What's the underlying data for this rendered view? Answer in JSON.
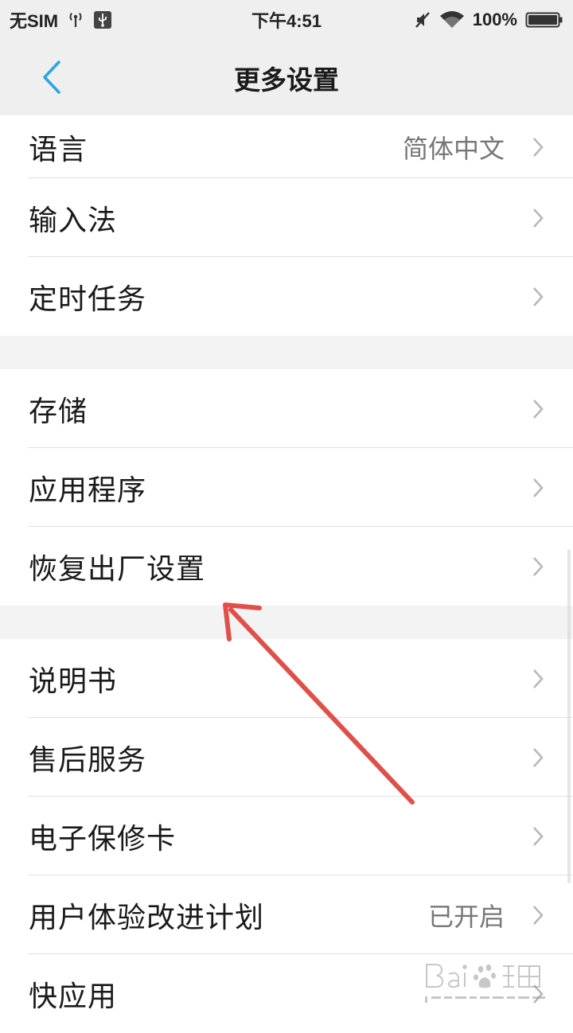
{
  "status_bar": {
    "carrier": "无SIM",
    "time": "下午4:51",
    "battery": "100%"
  },
  "header": {
    "title": "更多设置"
  },
  "groups": [
    {
      "items": [
        {
          "label": "语言",
          "value": "简体中文"
        },
        {
          "label": "输入法",
          "value": ""
        },
        {
          "label": "定时任务",
          "value": ""
        }
      ]
    },
    {
      "items": [
        {
          "label": "存储",
          "value": ""
        },
        {
          "label": "应用程序",
          "value": ""
        },
        {
          "label": "恢复出厂设置",
          "value": ""
        }
      ]
    },
    {
      "items": [
        {
          "label": "说明书",
          "value": ""
        },
        {
          "label": "售后服务",
          "value": ""
        },
        {
          "label": "电子保修卡",
          "value": ""
        },
        {
          "label": "用户体验改进计划",
          "value": "已开启"
        },
        {
          "label": "快应用",
          "value": ""
        }
      ]
    }
  ],
  "colors": {
    "accent": "#2aa6e0",
    "annotation": "#e0504a",
    "chevron": "#b8b8b8"
  },
  "icons": {
    "back": "chevron-left-icon",
    "chevron": "chevron-right-icon",
    "signal": "antenna-icon",
    "usb": "usb-icon",
    "mute": "mute-icon",
    "wifi": "wifi-icon",
    "battery": "battery-icon"
  }
}
